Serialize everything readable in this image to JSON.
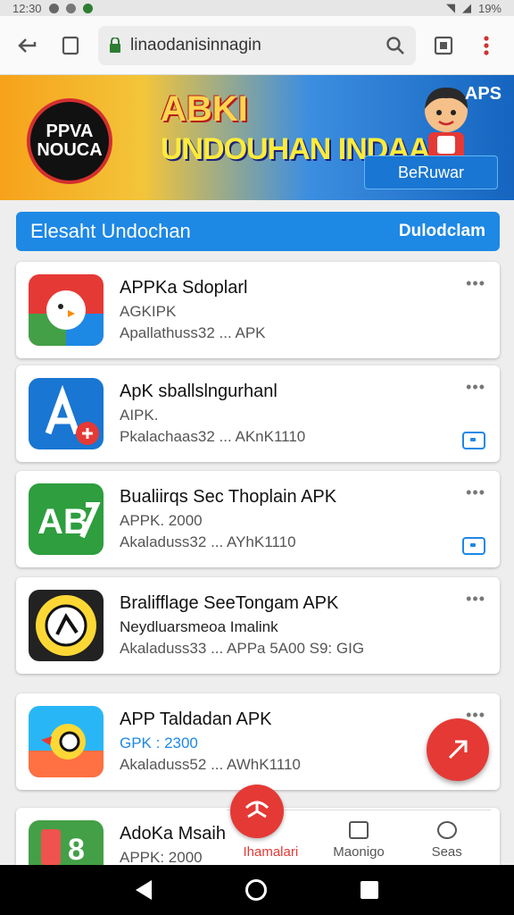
{
  "status_bar": {
    "time": "12:30",
    "battery": "19%"
  },
  "browser": {
    "url": "linaodanisinnagin"
  },
  "banner": {
    "badge_line1": "PPVA",
    "badge_line2": "NOUCA",
    "title": "ABKI",
    "subtitle": "UNDOUHAN INDAAIA",
    "apps_tag": "APS",
    "button_label": "BeRuwar"
  },
  "section": {
    "title": "Elesaht Undochan",
    "link": "Dulodclam"
  },
  "apps": [
    {
      "name": "APPKa Sdoplarl",
      "meta": "AGKIPK",
      "size": "Apallathuss32 ... APK",
      "download_badge": false
    },
    {
      "name": "ApK sballslngurhanl",
      "meta": "AIPK.",
      "size": "Pkalachaas32 ... AKnK1110",
      "download_badge": true
    },
    {
      "name": "Bualiirqs Sec Thoplain APK",
      "meta": "APPK. 2000",
      "size": "Akaladuss32 ... AYhK1110",
      "download_badge": true
    },
    {
      "name": "Bralifflage SeeTongam APK",
      "meta": "Neydluarsmeoa Imalink",
      "size": "Akaladuss33 ... APPa 5A00 S9: GIG",
      "download_badge": false
    },
    {
      "name": "APP Taldadan APK",
      "meta": "GPK : 2300",
      "size": "Akaladuss52 ... AWhK1110",
      "download_badge": true
    },
    {
      "name": "AdoKa Msaih",
      "meta": "APPK: 2000",
      "size": "",
      "download_badge": false
    }
  ],
  "bottom_nav": {
    "items": [
      "Ihamalari",
      "Maonigo",
      "Seas"
    ]
  },
  "colors": {
    "accent_blue": "#1e88e5",
    "accent_red": "#e53935"
  }
}
